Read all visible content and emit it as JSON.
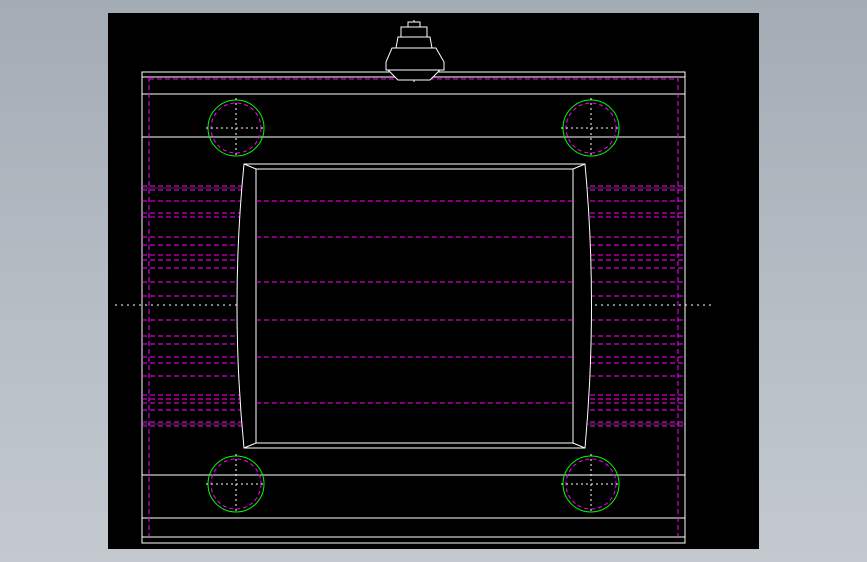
{
  "viewport": {
    "background": "#000000",
    "page_background": "#b0b8c0"
  },
  "colors": {
    "outline": "#ffffff",
    "hidden": "#ff00ff",
    "bolt": "#00ff00",
    "centerline": "#ffffff"
  },
  "drawing": {
    "type": "cad-mold-plate-front-view",
    "bolt_holes": 4,
    "grease_fitting": true
  }
}
